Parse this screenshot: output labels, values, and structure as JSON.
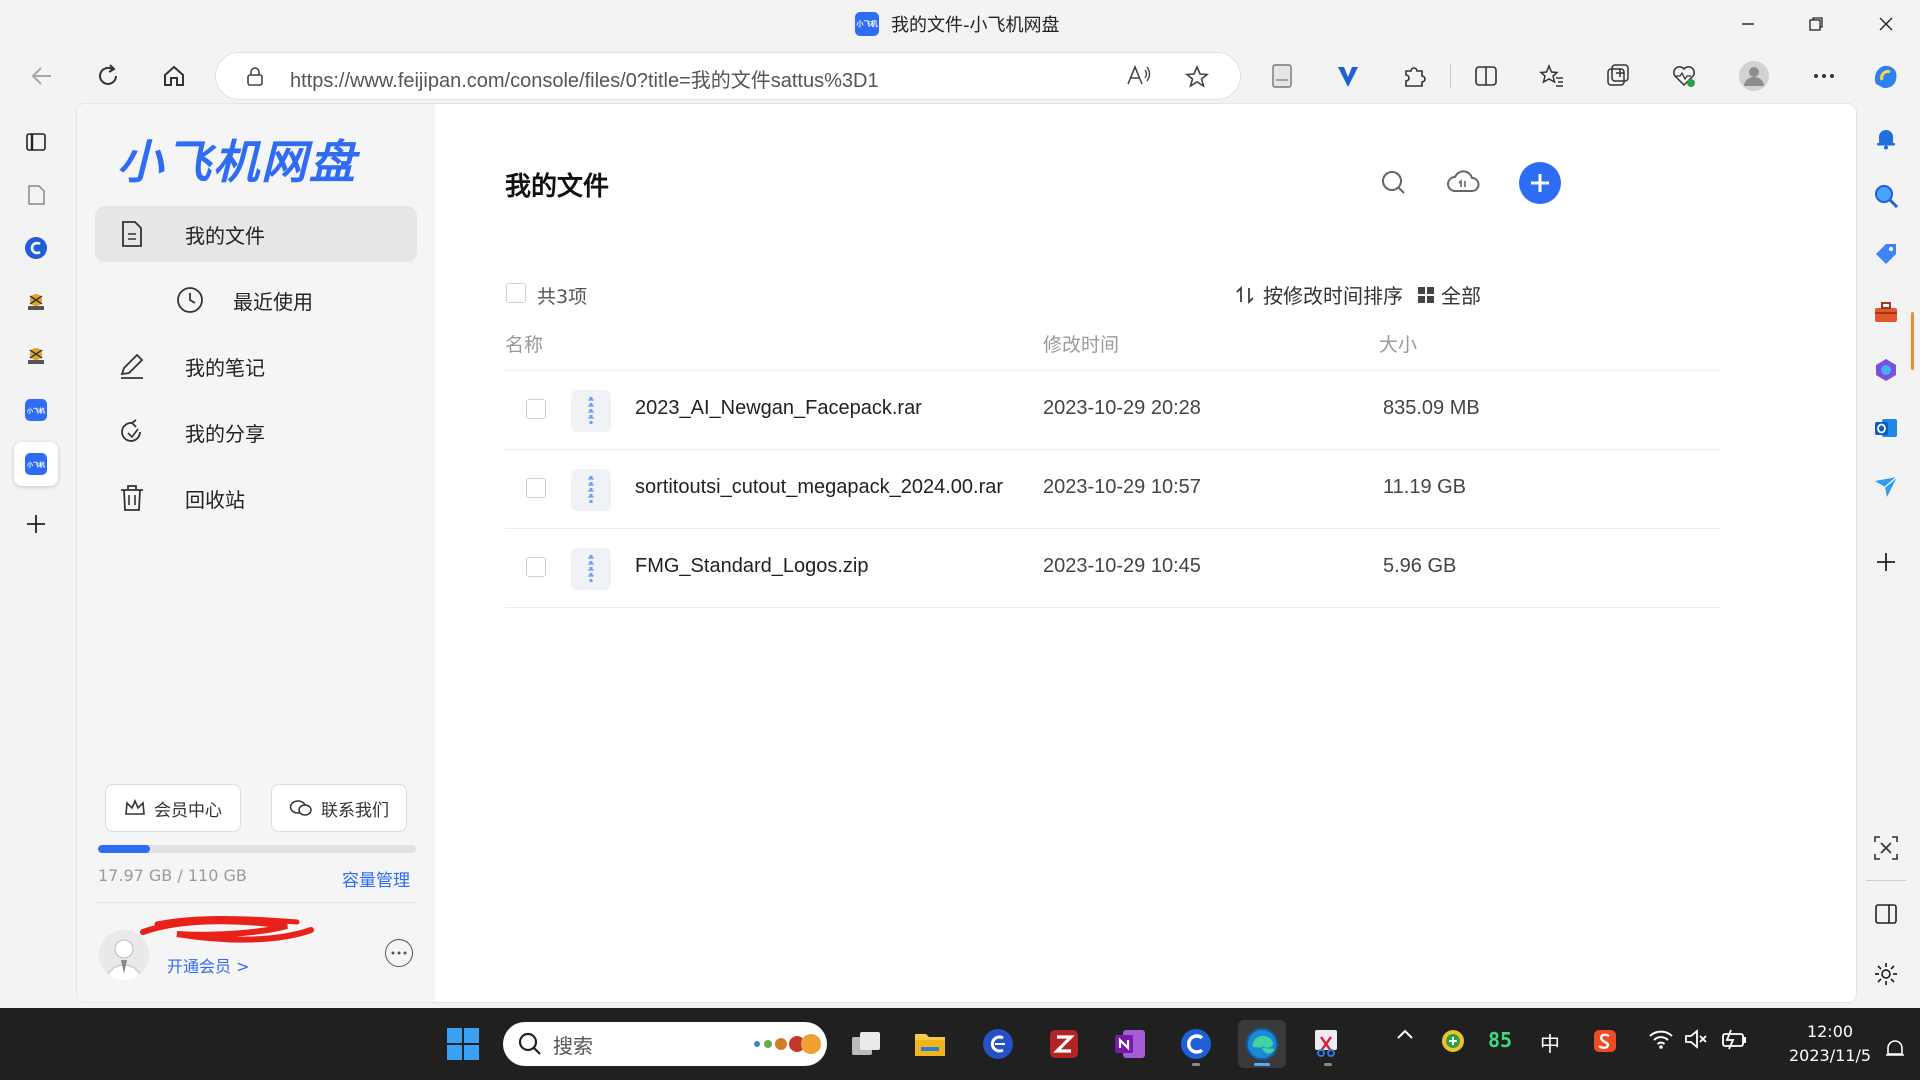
{
  "window": {
    "title": "我的文件-小飞机网盘",
    "favicon_text": "小飞机"
  },
  "browser": {
    "url": "https://www.feijipan.com/console/files/0?title=我的文件sattus%3D1"
  },
  "tabs": {
    "mini_logo_text": "小飞机"
  },
  "sidebar": {
    "logo": "小飞机网盘",
    "menu": {
      "my_files": "我的文件",
      "recent": "最近使用",
      "notes": "我的笔记",
      "shares": "我的分享",
      "recycle": "回收站"
    },
    "member_center": "会员中心",
    "contact_us": "联系我们",
    "storage": {
      "used_text": "17.97 GB / 110 GB",
      "used_fraction": 0.163,
      "manage": "容量管理"
    },
    "user": {
      "member_link": "开通会员 >"
    }
  },
  "main": {
    "title": "我的文件",
    "count": "共3项",
    "sort_label": "按修改时间排序",
    "view_label": "全部",
    "columns": {
      "name": "名称",
      "modified": "修改时间",
      "size": "大小"
    },
    "files": [
      {
        "name": "2023_AI_Newgan_Facepack.rar",
        "modified": "2023-10-29 20:28",
        "size": "835.09 MB"
      },
      {
        "name": "sortitoutsi_cutout_megapack_2024.00.rar",
        "modified": "2023-10-29 10:57",
        "size": "11.19 GB"
      },
      {
        "name": "FMG_Standard_Logos.zip",
        "modified": "2023-10-29 10:45",
        "size": "5.96 GB"
      }
    ]
  },
  "taskbar": {
    "search_placeholder": "搜索",
    "tray_number": "85",
    "ime": "中",
    "time": "12:00",
    "date": "2023/11/5"
  },
  "colors": {
    "accent": "#2f6cf6",
    "taskbar": "#202020"
  }
}
